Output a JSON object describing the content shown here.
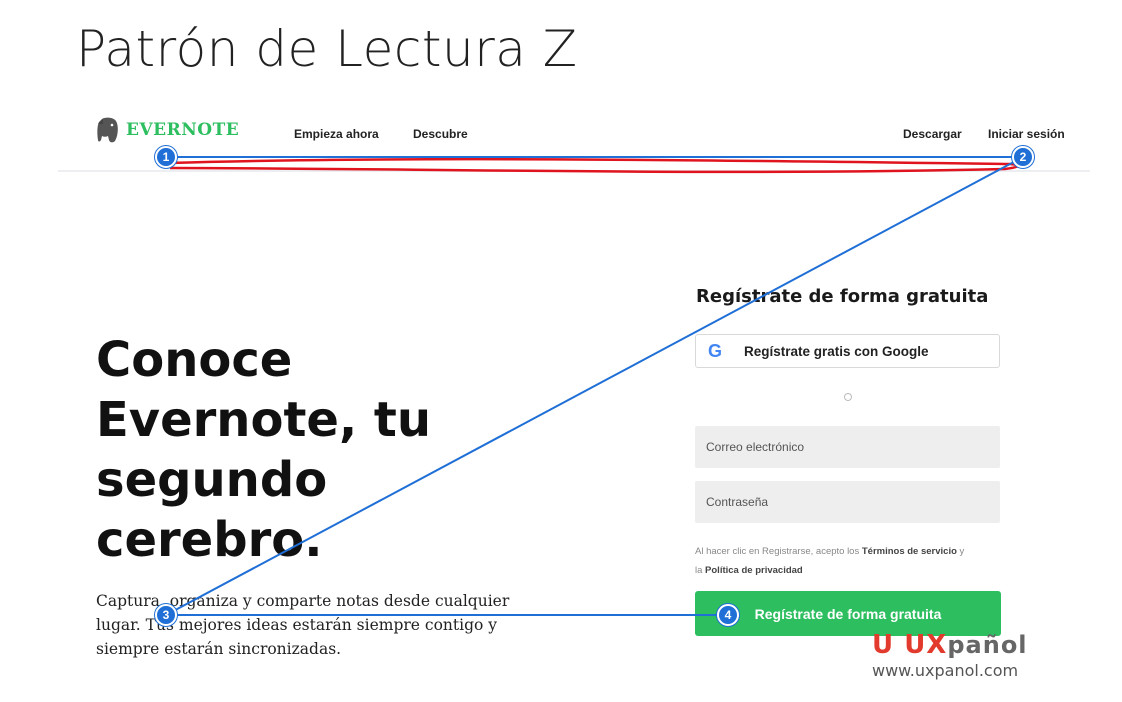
{
  "slide": {
    "title": "Patrón de Lectura Z"
  },
  "header": {
    "logo_text": "EVERNOTE",
    "nav": [
      "Empieza ahora",
      "Descubre"
    ],
    "right_nav": [
      "Descargar",
      "Iniciar sesión"
    ]
  },
  "hero": {
    "lines": [
      "Conoce",
      "Evernote, tu",
      "segundo",
      "cerebro."
    ],
    "body_lines": [
      "Captura, organiza y comparte notas desde cualquier",
      "lugar. Tus mejores ideas estarán siempre contigo y",
      "siempre estarán sincronizadas."
    ]
  },
  "form": {
    "heading": "Regístrate de forma gratuita",
    "google_button": "Regístrate gratis con Google",
    "email_placeholder": "Correo electrónico",
    "password_placeholder": "Contraseña",
    "legal_prefix": "Al hacer clic en Registrarse, acepto los",
    "terms_link": "Términos de servicio",
    "legal_middle": "y",
    "legal_article": "la",
    "privacy_link": "Política de privacidad",
    "submit_label": "Regístrate de forma gratuita"
  },
  "annotations": {
    "markers": [
      "1",
      "2",
      "3",
      "4"
    ],
    "line_color": "#1f6fd6",
    "highlight_color": "#e0141e"
  },
  "watermark": {
    "brand_u": "U",
    "brand_ux": "UX",
    "brand_rest": "pañol",
    "url": "www.uxpanol.com"
  },
  "colors": {
    "accent": "#2dbe60",
    "badge": "#1f6fd6"
  }
}
